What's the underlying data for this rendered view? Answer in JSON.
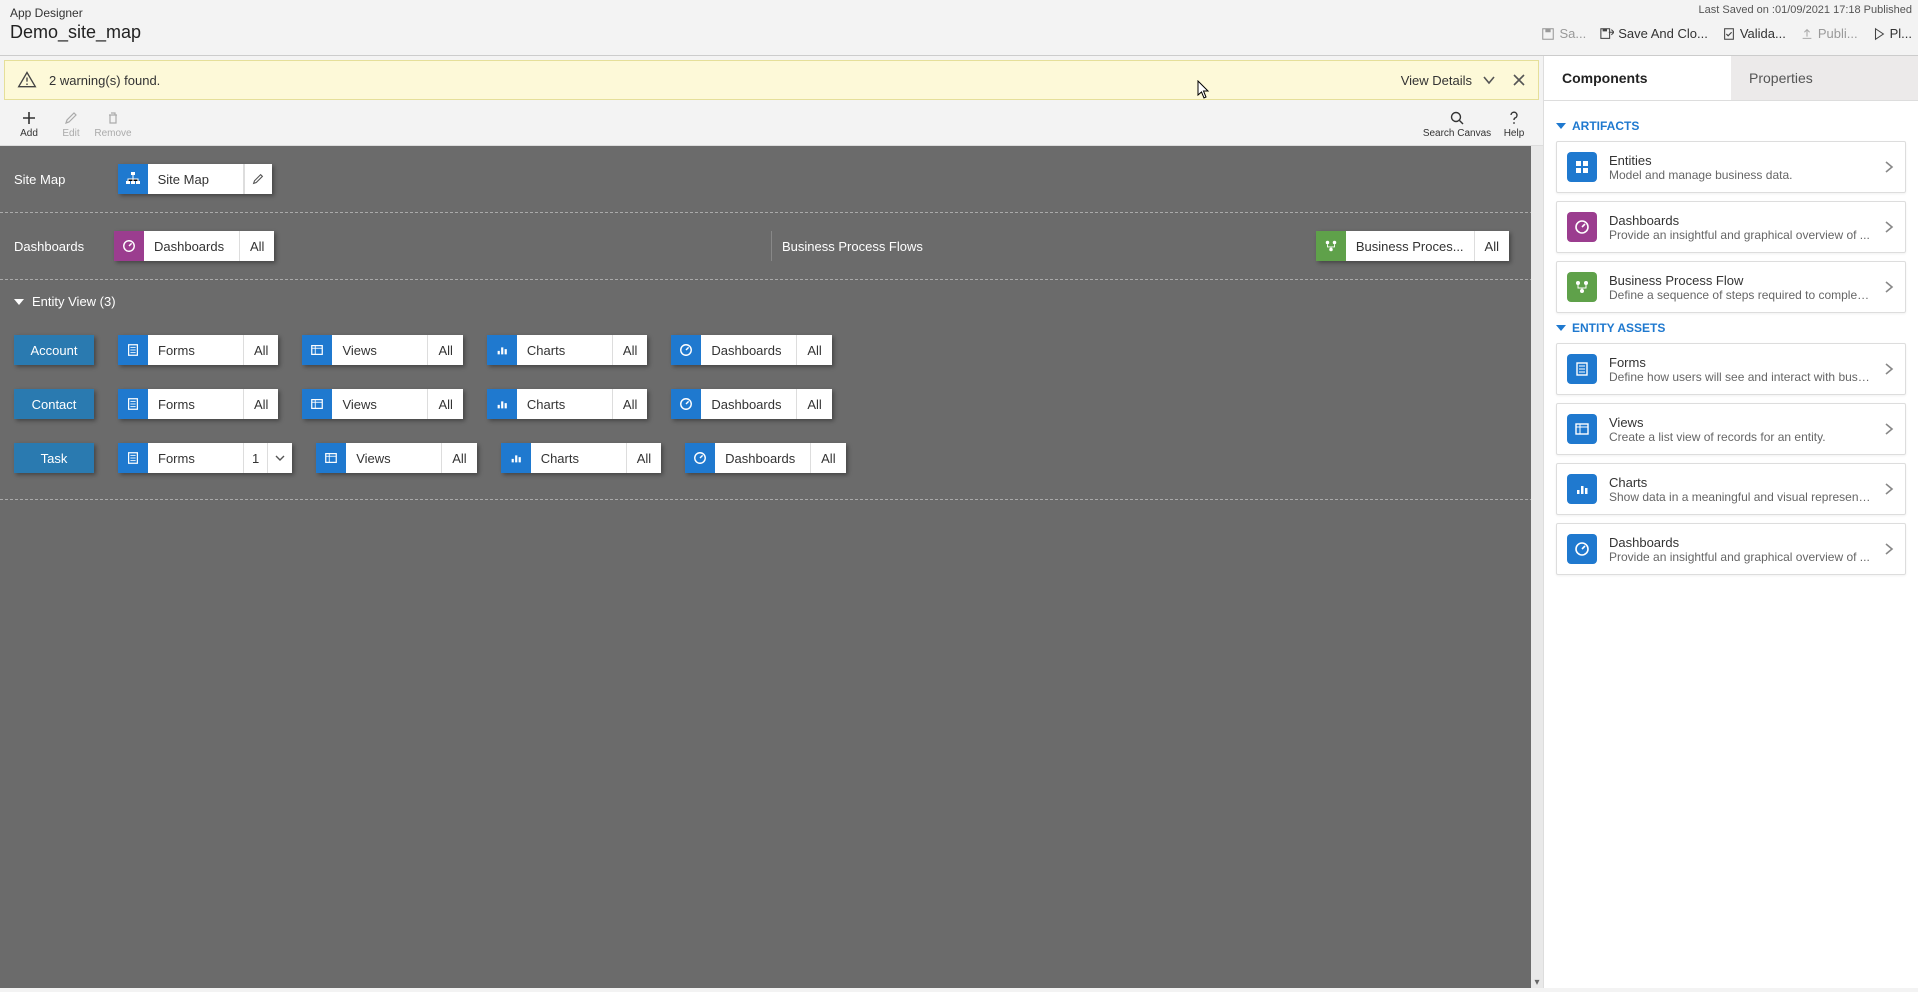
{
  "header": {
    "app_title": "App Designer",
    "app_name": "Demo_site_map",
    "last_saved": "Last Saved on :01/09/2021 17:18 Published",
    "actions": {
      "save": "Sa...",
      "save_and_close": "Save And Clo...",
      "validate": "Valida...",
      "publish": "Publi...",
      "play": "Pl..."
    }
  },
  "warning": {
    "text": "2 warning(s) found.",
    "view_details": "View Details"
  },
  "toolbar": {
    "add": "Add",
    "edit": "Edit",
    "remove": "Remove",
    "search": "Search Canvas",
    "help": "Help"
  },
  "canvas": {
    "sitemap": {
      "label": "Site Map",
      "tile": "Site Map"
    },
    "dashboards": {
      "label": "Dashboards",
      "tile": "Dashboards",
      "count": "All"
    },
    "bpf": {
      "label": "Business Process Flows",
      "tile": "Business Proces...",
      "count": "All"
    },
    "entity_view": {
      "label": "Entity View (3)"
    },
    "entities": [
      {
        "name": "Account",
        "forms": {
          "label": "Forms",
          "count": "All"
        },
        "views": {
          "label": "Views",
          "count": "All"
        },
        "charts": {
          "label": "Charts",
          "count": "All"
        },
        "dashboards": {
          "label": "Dashboards",
          "count": "All"
        }
      },
      {
        "name": "Contact",
        "forms": {
          "label": "Forms",
          "count": "All"
        },
        "views": {
          "label": "Views",
          "count": "All"
        },
        "charts": {
          "label": "Charts",
          "count": "All"
        },
        "dashboards": {
          "label": "Dashboards",
          "count": "All"
        }
      },
      {
        "name": "Task",
        "forms": {
          "label": "Forms",
          "count": "1"
        },
        "views": {
          "label": "Views",
          "count": "All"
        },
        "charts": {
          "label": "Charts",
          "count": "All"
        },
        "dashboards": {
          "label": "Dashboards",
          "count": "All"
        }
      }
    ]
  },
  "panel": {
    "tabs": {
      "components": "Components",
      "properties": "Properties"
    },
    "groups": {
      "artifacts": "ARTIFACTS",
      "entity_assets": "ENTITY ASSETS"
    },
    "items": {
      "entities": {
        "title": "Entities",
        "desc": "Model and manage business data."
      },
      "dashboards": {
        "title": "Dashboards",
        "desc": "Provide an insightful and graphical overview of ..."
      },
      "bpf": {
        "title": "Business Process Flow",
        "desc": "Define a sequence of steps required to complete..."
      },
      "forms": {
        "title": "Forms",
        "desc": "Define how users will see and interact with busin..."
      },
      "views": {
        "title": "Views",
        "desc": "Create a list view of records for an entity."
      },
      "charts": {
        "title": "Charts",
        "desc": "Show data in a meaningful and visual representa..."
      },
      "dashboards2": {
        "title": "Dashboards",
        "desc": "Provide an insightful and graphical overview of ..."
      }
    }
  }
}
